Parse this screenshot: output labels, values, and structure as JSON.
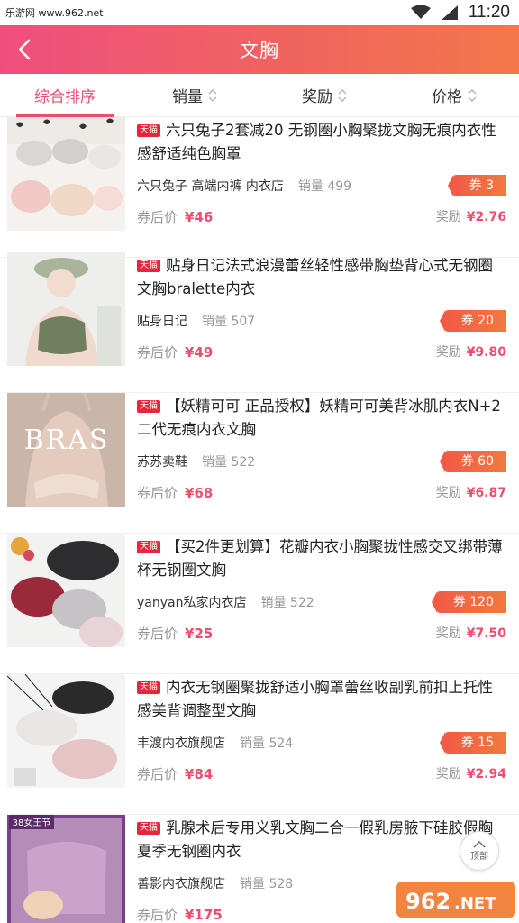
{
  "status": {
    "watermark": "乐游网 www.962.net",
    "time": "11:20"
  },
  "header": {
    "title": "文胸"
  },
  "tabs": [
    {
      "label": "综合排序",
      "active": true
    },
    {
      "label": "销量",
      "active": false
    },
    {
      "label": "奖励",
      "active": false
    },
    {
      "label": "价格",
      "active": false
    }
  ],
  "labels": {
    "tmall": "天猫",
    "after_coupon": "券后价",
    "reward": "奖励",
    "sales": "销量",
    "coupon": "券",
    "to_top": "顶部"
  },
  "items": [
    {
      "title": "六只兔子2套减20 无钢圈小胸聚拢文胸无痕内衣性感舒适纯色胸罩",
      "shop": "六只兔子 高端内裤 内衣店",
      "sales": "销量 499",
      "coupon": "券 3",
      "price": "¥46",
      "reward": "¥2.76"
    },
    {
      "title": "贴身日记法式浪漫蕾丝轻性感带胸垫背心式无钢圈文胸bralette内衣",
      "shop": "贴身日记",
      "sales": "销量 507",
      "coupon": "券 20",
      "price": "¥49",
      "reward": "¥9.80"
    },
    {
      "title": "【妖精可可 正品授权】妖精可可美背冰肌内衣N+2二代无痕内衣文胸",
      "shop": "苏苏卖鞋",
      "sales": "销量 522",
      "coupon": "券 60",
      "price": "¥68",
      "reward": "¥6.87"
    },
    {
      "title": "【买2件更划算】花瓣内衣小胸聚拢性感交叉绑带薄杯无钢圈文胸",
      "shop": "yanyan私家内衣店",
      "sales": "销量 522",
      "coupon": "券 120",
      "price": "¥25",
      "reward": "¥7.50"
    },
    {
      "title": "内衣无钢圈聚拢舒适小胸罩蕾丝收副乳前扣上托性感美背调整型文胸",
      "shop": "丰渡内衣旗舰店",
      "sales": "销量 524",
      "coupon": "券 15",
      "price": "¥84",
      "reward": "¥2.94"
    },
    {
      "title": "乳腺术后专用义乳文胸二合一假乳房腋下硅胶假胸夏季无钢圈内衣",
      "shop": "善影内衣旗舰店",
      "sales": "销量 528",
      "coupon": "",
      "price": "¥175",
      "reward": ""
    }
  ],
  "thumb_badges": {
    "bras_text": "BRAS",
    "promo_tag": "38女王节"
  },
  "colors": {
    "accent": "#ee4d6e",
    "header_start": "#ef4f7e",
    "header_end": "#f2784a",
    "tmall": "#e5263b"
  }
}
